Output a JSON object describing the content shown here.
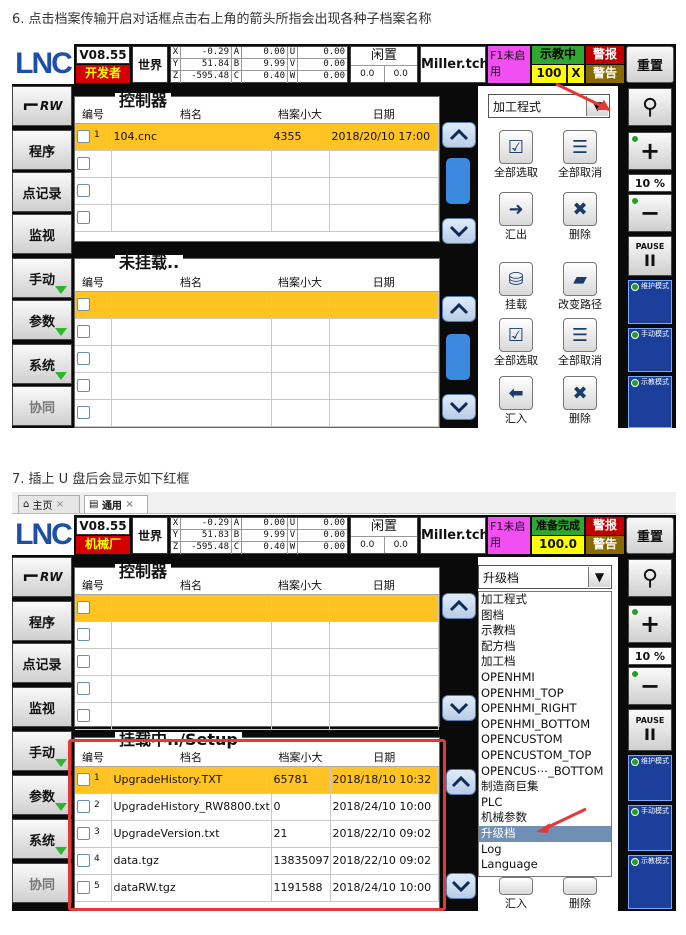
{
  "caption1": "6. 点击档案传输开启对话框点击右上角的箭头所指会出现各种子档案名称",
  "caption2": "7. 插上 U 盘后会显示如下红框",
  "logo": "LNC",
  "version": "V08.55",
  "mode1": "开发者",
  "mode2": "机械厂",
  "world": "世界",
  "coords": [
    {
      "k": "X",
      "v": "-0.29",
      "k2": "A",
      "v2": "0.00",
      "k3": "U",
      "v3": "0.00"
    },
    {
      "k": "Y",
      "v": "51.84",
      "k2": "B",
      "v2": "9.99",
      "k3": "V",
      "v3": "0.00"
    },
    {
      "k": "Z",
      "v": "-595.48",
      "k2": "C",
      "v2": "0.40",
      "k3": "W",
      "v3": "0.00"
    }
  ],
  "coords2": [
    {
      "k": "X",
      "v": "-0.29",
      "k2": "A",
      "v2": "0.00",
      "k3": "U",
      "v3": "0.00"
    },
    {
      "k": "Y",
      "v": "51.83",
      "k2": "B",
      "v2": "9.99",
      "k3": "V",
      "v3": "0.00"
    },
    {
      "k": "Z",
      "v": "-595.48",
      "k2": "C",
      "v2": "0.40",
      "k3": "W",
      "v3": "0.00"
    }
  ],
  "idle": "闲置",
  "idle_a": "0.0",
  "idle_b": "0.0",
  "user": "Miller.tch",
  "f1": "F1未启用",
  "teach1": "示教中",
  "teach1_val": "100",
  "teach1_x": "X",
  "teach2": "准备完成",
  "teach2_val": "100.0 %",
  "alarm": "警报",
  "warn": "警告",
  "reset": "重置",
  "side": [
    "程序",
    "点记录",
    "监视",
    "手动",
    "参数",
    "系统",
    "协同"
  ],
  "rw": "RW",
  "right": {
    "plus": "+",
    "pct": "10 %",
    "minus": "−",
    "pause": "PAUSE",
    "pause_sym": "II",
    "protect": "维护模式",
    "manual": "手动模式",
    "teach": "示教模式"
  },
  "panel1_title": "控制器",
  "panel2_title": "未挂载..",
  "panel2b_title": "挂载中../Setup",
  "headers": {
    "no": "编号",
    "name": "档名",
    "size": "档案小大",
    "date": "日期"
  },
  "files1": [
    {
      "n": "1",
      "name": "104.cnc",
      "size": "4355",
      "date": "2018/20/10 17:00"
    }
  ],
  "files2": [
    {
      "n": "1",
      "name": "UpgradeHistory.TXT",
      "size": "65781",
      "date": "2018/18/10 10:32"
    },
    {
      "n": "2",
      "name": "UpgradeHistory_RW8800.txt",
      "size": "0",
      "date": "2018/24/10 10:00"
    },
    {
      "n": "3",
      "name": "UpgradeVersion.txt",
      "size": "21",
      "date": "2018/22/10 09:02"
    },
    {
      "n": "4",
      "name": "data.tgz",
      "size": "13835097",
      "date": "2018/22/10 09:02"
    },
    {
      "n": "5",
      "name": "dataRW.tgz",
      "size": "1191588",
      "date": "2018/24/10 10:00"
    }
  ],
  "dropdown1": "加工程式",
  "dropdown2": "升级档",
  "actions": {
    "select_all": "全部选取",
    "cancel_all": "全部取消",
    "export": "汇出",
    "delete": "删除",
    "mount": "挂载",
    "change_path": "改变路径",
    "import": "汇入"
  },
  "dd_options": [
    "加工程式",
    "图档",
    "示教档",
    "配方档",
    "加工档",
    "OPENHMI",
    "OPENHMI_TOP",
    "OPENHMI_RIGHT",
    "OPENHMI_BOTTOM",
    "OPENCUSTOM",
    "OPENCUSTOM_TOP",
    "OPENCUS⋯_BOTTOM",
    "制造商巨集",
    "PLC",
    "机械参数",
    "升级档",
    "Log",
    "Language"
  ],
  "dd_selected_index": 15,
  "tabs": {
    "home": "主页",
    "general": "通用"
  },
  "accent_red": "#e53935"
}
